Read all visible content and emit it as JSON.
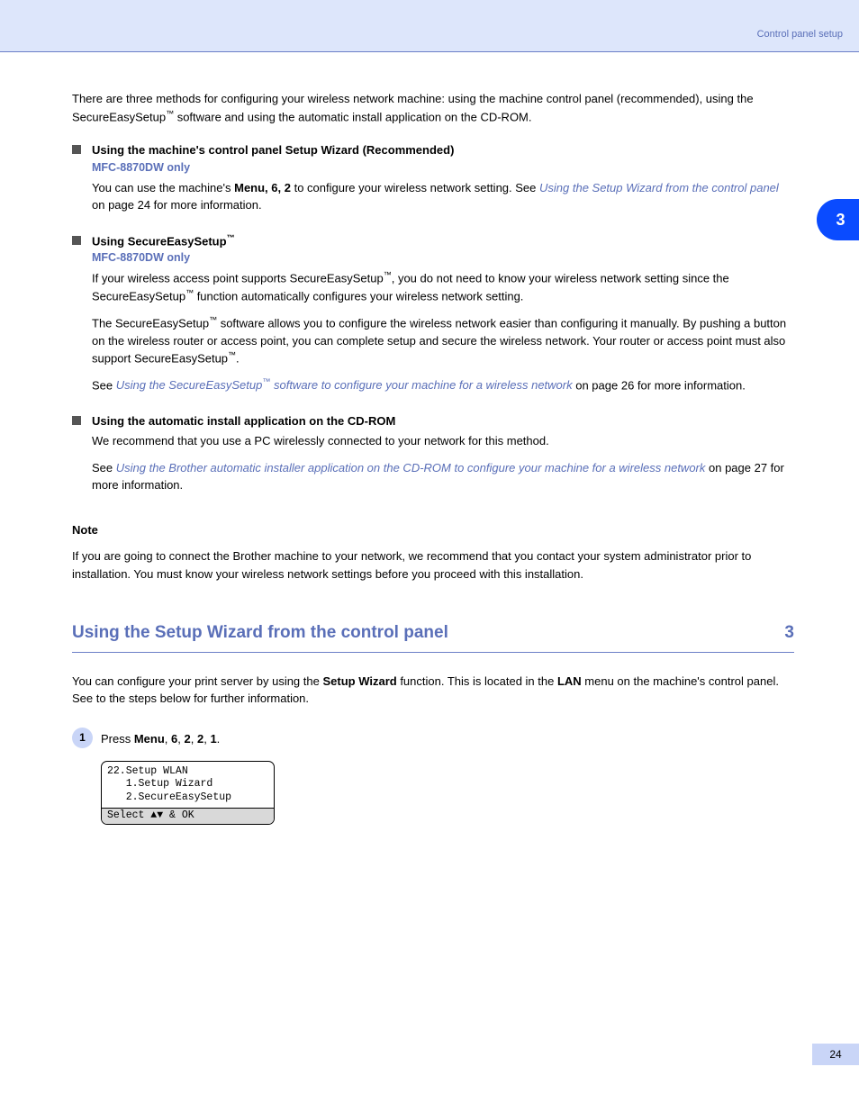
{
  "banner": {
    "right_text": "Control panel setup"
  },
  "side_tab": "3",
  "intro": {
    "lead": "There are three methods for configuring your wireless network machine: using the machine control panel (recommended), using the SecureEasySetup",
    "tm": "™",
    "lead_tail": " software and using the automatic install application on the CD-ROM."
  },
  "methods": [
    {
      "title": "Using the machine's control panel Setup Wizard (Recommended)",
      "sub": "MFC-8870DW only",
      "desc_parts": [
        "You can use the machine's ",
        "Menu, 6, 2",
        " to configure your wireless network setting. See ",
        "Using the Setup Wizard from the control panel",
        " on page 24 for more information."
      ]
    },
    {
      "title_parts": [
        "Using SecureEasySetup",
        "™"
      ],
      "sub": "MFC-8870DW only",
      "desc_parts": [
        "If your wireless access point supports SecureEasySetup",
        "™",
        ", you do not need to know your wireless network setting since the SecureEasySetup",
        "™",
        " function automatically configures your wireless network setting.",
        "The SecureEasySetup",
        "™",
        " software allows you to configure the wireless network easier than configuring it manually. By pushing a button on the wireless router or access point, you can complete setup and secure the wireless network. Your router or access point must also support SecureEasySetup",
        "™",
        ".",
        "See ",
        "Using the SecureEasySetup",
        "™",
        " software to configure your machine for a wireless network",
        " on page 26 for more information."
      ]
    },
    {
      "title": "Using the automatic install application on the CD-ROM",
      "desc_parts": [
        "We recommend that you use a PC wirelessly connected to your network for this method.",
        "See ",
        "Using the Brother automatic installer application on the CD-ROM to configure your machine for a wireless network",
        " on page 27 for more information."
      ]
    }
  ],
  "note": {
    "title": "Note",
    "body_parts": [
      "If you are going to connect the Brother machine to your network, we recommend that you contact your system administrator prior to installation. You must know your wireless network settings before you proceed with this installation."
    ]
  },
  "section": {
    "heading": "Using the Setup Wizard from the control panel",
    "heading_right": "3",
    "paragraph_parts": [
      "You can configure your print server by using the ",
      "Setup Wizard",
      " function. This is located in the ",
      "LAN",
      " menu on the machine's control panel. See to the steps below for further information."
    ],
    "steps": [
      {
        "num": "1",
        "text_parts": [
          "Press ",
          "Menu",
          ", ",
          "6",
          ", ",
          "2",
          ", ",
          "2",
          ", ",
          "1",
          "."
        ]
      }
    ],
    "lcd": {
      "line1": "22.Setup WLAN",
      "line2": "   1.Setup Wizard",
      "line3": "   2.SecureEasySetup",
      "footer": "Select ▲▼ & OK"
    }
  },
  "page_number": "24"
}
